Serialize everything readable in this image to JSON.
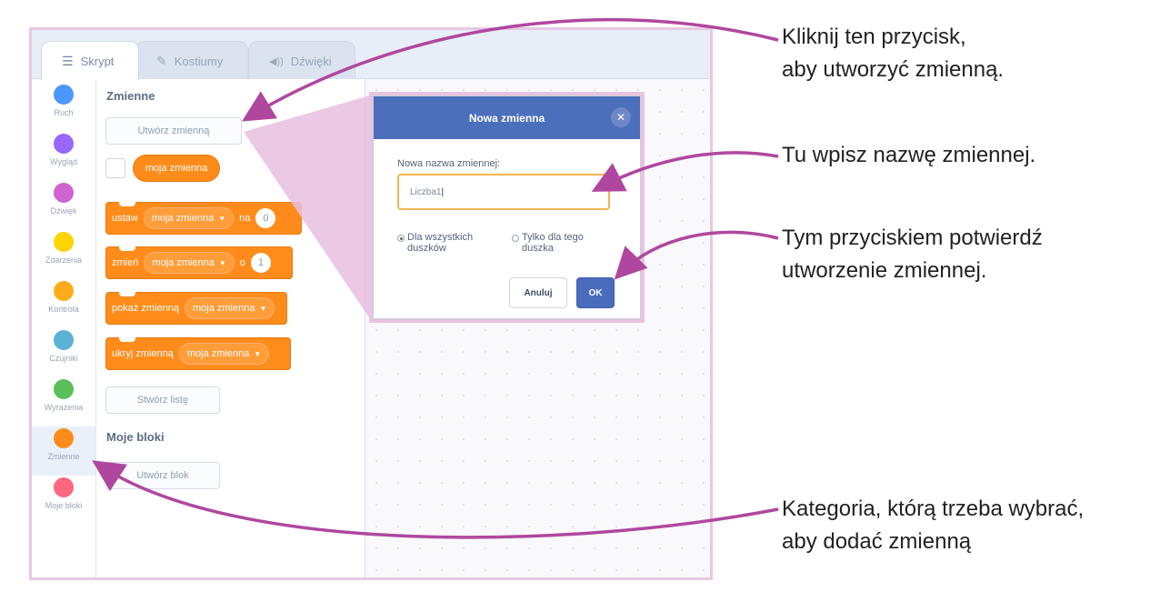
{
  "tabs": [
    {
      "label": "Skrypt",
      "icon": "script-icon"
    },
    {
      "label": "Kostiumy",
      "icon": "brush-icon"
    },
    {
      "label": "Dźwięki",
      "icon": "speaker-icon"
    }
  ],
  "categories": [
    {
      "label": "Ruch",
      "color": "#4c97ff"
    },
    {
      "label": "Wygląd",
      "color": "#9966ff"
    },
    {
      "label": "Dźwięk",
      "color": "#cf63cf"
    },
    {
      "label": "Zdarzenia",
      "color": "#ffd500"
    },
    {
      "label": "Kontrola",
      "color": "#ffab19"
    },
    {
      "label": "Czujniki",
      "color": "#5cb1d6"
    },
    {
      "label": "Wyrażenia",
      "color": "#59c059"
    },
    {
      "label": "Zmienne",
      "color": "#ff8c1a",
      "selected": true
    },
    {
      "label": "Moje bloki",
      "color": "#ff6680"
    }
  ],
  "palette": {
    "variables_title": "Zmienne",
    "create_variable_button": "Utwórz zmienną",
    "variable_reporter": "moja zmienna",
    "blocks": {
      "set": {
        "label": "ustaw",
        "var": "moja zmienna",
        "to": "na",
        "value": "0"
      },
      "change": {
        "label": "zmień",
        "var": "moja zmienna",
        "by": "o",
        "value": "1"
      },
      "show": {
        "label": "pokaż zmienną",
        "var": "moja zmienna"
      },
      "hide": {
        "label": "ukryj zmienną",
        "var": "moja zmienna"
      }
    },
    "create_list_button": "Stwórz listę",
    "my_blocks_title": "Moje bloki",
    "create_block_button": "Utwórz blok"
  },
  "dialog": {
    "title": "Nowa zmienna",
    "name_label": "Nowa nazwa zmiennej:",
    "name_value": "Liczba1",
    "radio_all": "Dla wszystkich duszków",
    "radio_this": "Tylko dla tego duszka",
    "cancel": "Anuluj",
    "ok": "OK"
  },
  "callouts": {
    "c1": "Kliknij ten przycisk,\naby utworzyć zmienną.",
    "c2": "Tu wpisz nazwę zmiennej.",
    "c3": "Tym przyciskiem potwierdź\nutworzenie zmiennej.",
    "c4": "Kategoria, którą trzeba wybrać,\naby dodać zmienną"
  },
  "colors": {
    "accent_block": "#ff8c1a",
    "dialog_header": "#4c6fbc",
    "arrow": "#b0479f",
    "frame": "#e6c8e4"
  }
}
